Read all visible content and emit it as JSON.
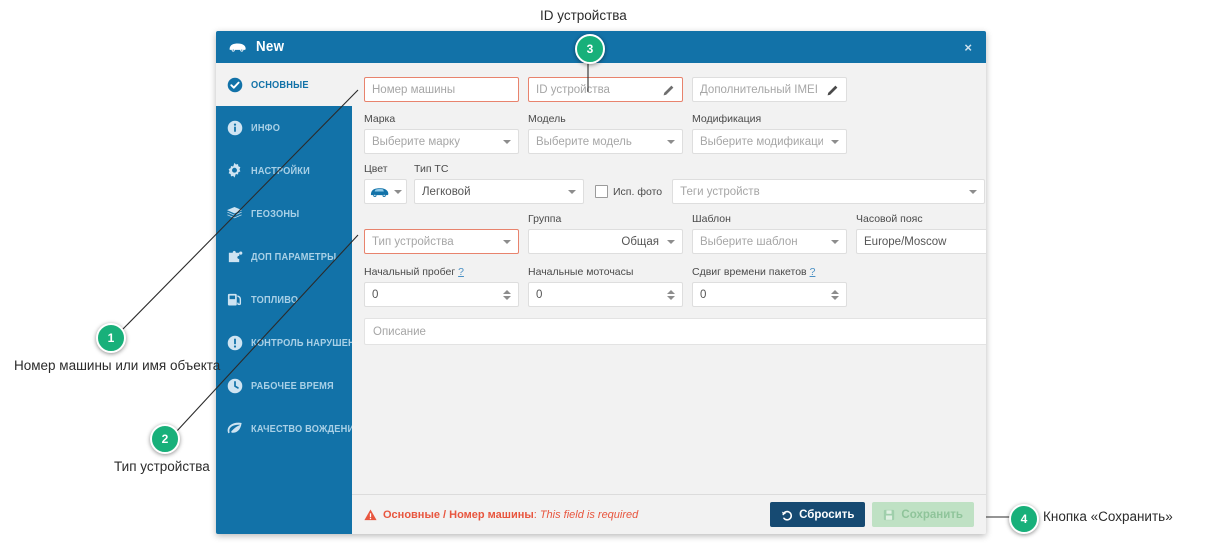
{
  "dialog": {
    "title": "New",
    "close_label": "×",
    "car_icon": "car-icon"
  },
  "sidebar": {
    "items": [
      {
        "label": "ОСНОВНЫЕ",
        "icon": "check-circle-icon",
        "active": true
      },
      {
        "label": "ИНФО",
        "icon": "info-circle-icon",
        "active": false
      },
      {
        "label": "НАСТРОЙКИ",
        "icon": "gear-icon",
        "active": false
      },
      {
        "label": "ГЕОЗОНЫ",
        "icon": "layers-icon",
        "active": false
      },
      {
        "label": "ДОП ПАРАМЕТРЫ",
        "icon": "puzzle-icon",
        "active": false
      },
      {
        "label": "ТОПЛИВО",
        "icon": "fuel-pump-icon",
        "active": false
      },
      {
        "label": "КОНТРОЛЬ НАРУШЕН...",
        "icon": "exclamation-circle-icon",
        "active": false
      },
      {
        "label": "РАБОЧЕЕ ВРЕМЯ",
        "icon": "clock-icon",
        "active": false
      },
      {
        "label": "КАЧЕСТВО ВОЖДЕНИЯ",
        "icon": "leaf-icon",
        "active": false
      }
    ]
  },
  "form": {
    "car_number": {
      "placeholder": "Номер машины",
      "value": "",
      "error": true
    },
    "device_id": {
      "placeholder": "ID устройства",
      "value": "",
      "error": true,
      "icon": "pencil-icon"
    },
    "extra_imei": {
      "placeholder": "Дополнительный IMEI",
      "value": "",
      "error": false,
      "icon": "pencil-icon"
    },
    "brand": {
      "label": "Марка",
      "placeholder": "Выберите марку",
      "value": ""
    },
    "model": {
      "label": "Модель",
      "placeholder": "Выберите модель",
      "value": ""
    },
    "modification": {
      "label": "Модификация",
      "placeholder": "Выберите модификацию",
      "value": ""
    },
    "color": {
      "label": "Цвет",
      "icon": "car-color-icon"
    },
    "vehicle_type": {
      "label": "Тип ТС",
      "value": "Легковой"
    },
    "use_photo": {
      "label": "Исп. фото",
      "checked": false
    },
    "device_tags": {
      "placeholder": "Теги устройств",
      "value": ""
    },
    "device_type": {
      "placeholder": "Тип устройства",
      "value": "",
      "error": true
    },
    "group": {
      "label": "Группа",
      "value": "Общая"
    },
    "template": {
      "label": "Шаблон",
      "placeholder": "Выберите шаблон",
      "value": ""
    },
    "timezone": {
      "label": "Часовой пояс",
      "value": "Europe/Moscow"
    },
    "initial_mileage": {
      "label": "Начальный пробег",
      "hint": "?",
      "value": "0"
    },
    "initial_engine_hours": {
      "label": "Начальные моточасы",
      "hint": "",
      "value": "0"
    },
    "packet_time_shift": {
      "label": "Сдвиг времени пакетов",
      "hint": "?",
      "value": "0"
    },
    "description": {
      "placeholder": "Описание",
      "value": ""
    }
  },
  "footer": {
    "error_prefix": "Основные / Номер машины",
    "error_sep": ":",
    "error_text": "This field is required",
    "reset_label": "Сбросить",
    "save_label": "Сохранить",
    "reset_icon": "undo-icon",
    "save_icon": "floppy-disk-icon",
    "warning_icon": "warning-triangle-icon"
  },
  "annotations": [
    {
      "number": "1",
      "text": "Номер машины или имя объекта"
    },
    {
      "number": "2",
      "text": "Тип устройства"
    },
    {
      "number": "3",
      "text": "ID устройства"
    },
    {
      "number": "4",
      "text": "Кнопка «Сохранить»"
    }
  ],
  "colors": {
    "brand_blue": "#1272a8",
    "marker_green": "#18b07a",
    "error_red": "#e8563f",
    "reset_btn": "#164a72",
    "save_btn": "#bfe1c4"
  }
}
